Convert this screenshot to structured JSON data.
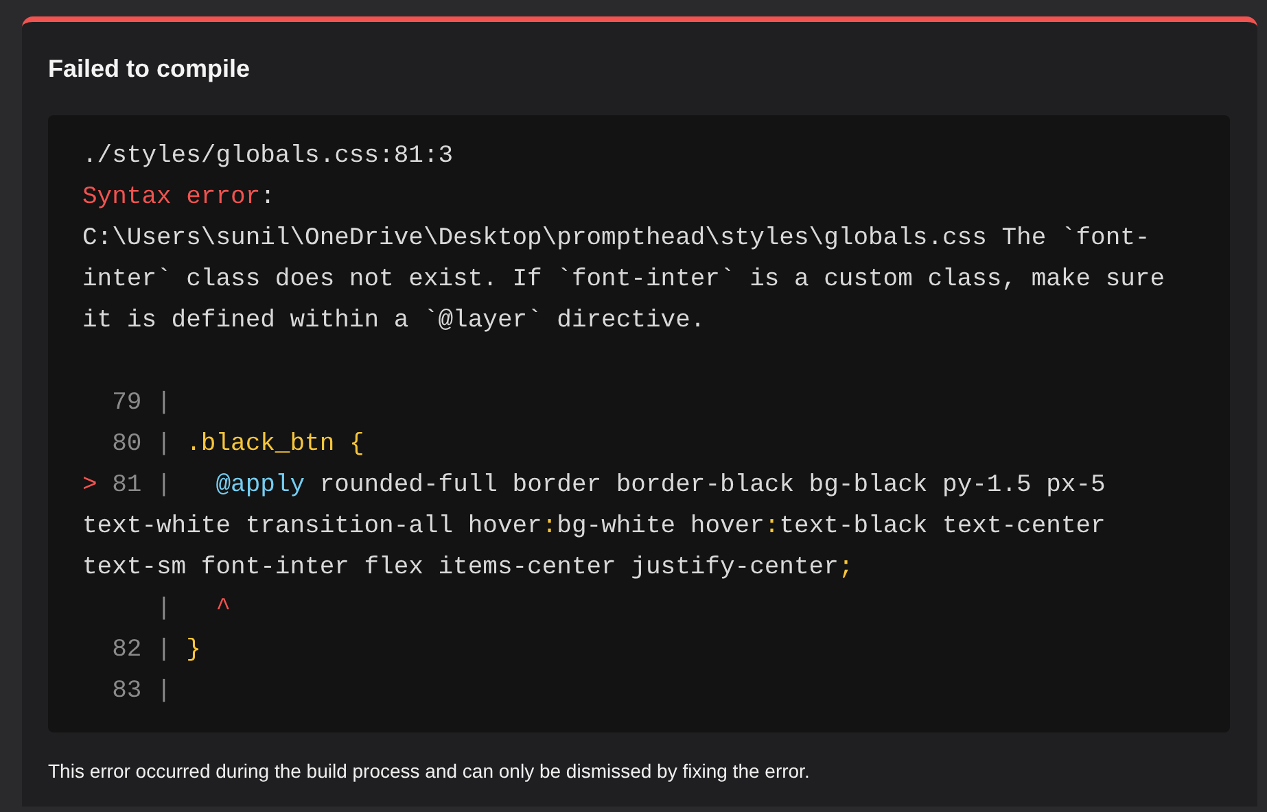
{
  "title": "Failed to compile",
  "message_lines": [
    [
      {
        "kind": "plain",
        "text": "./styles/globals.css:81:3"
      }
    ],
    [
      {
        "kind": "error",
        "text": "Syntax error"
      },
      {
        "kind": "plain",
        "text": ":"
      }
    ],
    [
      {
        "kind": "plain",
        "text": "C:\\Users\\sunil\\OneDrive\\Desktop\\prompthead\\styles\\globals.css The `font-"
      }
    ],
    [
      {
        "kind": "plain",
        "text": "inter` class does not exist. If `font-inter` is a custom class, make sure"
      }
    ],
    [
      {
        "kind": "plain",
        "text": "it is defined within a `@layer` directive."
      }
    ]
  ],
  "frame_lines": [
    [
      {
        "kind": "gutter",
        "text": "  79 |"
      }
    ],
    [
      {
        "kind": "gutter",
        "text": "  80 | "
      },
      {
        "kind": "selector",
        "text": ".black_btn {"
      }
    ],
    [
      {
        "kind": "error",
        "text": ">"
      },
      {
        "kind": "gutter",
        "text": " 81 |   "
      },
      {
        "kind": "keyword",
        "text": "@apply"
      },
      {
        "kind": "plain",
        "text": " rounded-full border border-black bg-black py-1.5 px-5"
      }
    ],
    [
      {
        "kind": "plain",
        "text": "text-white transition-all hover"
      },
      {
        "kind": "punct",
        "text": ":"
      },
      {
        "kind": "plain",
        "text": "bg-white hover"
      },
      {
        "kind": "punct",
        "text": ":"
      },
      {
        "kind": "plain",
        "text": "text-black text-center"
      }
    ],
    [
      {
        "kind": "plain",
        "text": "text-sm font-inter flex items-center justify-center"
      },
      {
        "kind": "punct",
        "text": ";"
      }
    ],
    [
      {
        "kind": "gutter",
        "text": "     |   "
      },
      {
        "kind": "error",
        "text": "^"
      }
    ],
    [
      {
        "kind": "gutter",
        "text": "  82 | "
      },
      {
        "kind": "selector",
        "text": "}"
      }
    ],
    [
      {
        "kind": "gutter",
        "text": "  83 |"
      }
    ]
  ],
  "footer": "This error occurred during the build process and can only be dismissed by fixing the error."
}
